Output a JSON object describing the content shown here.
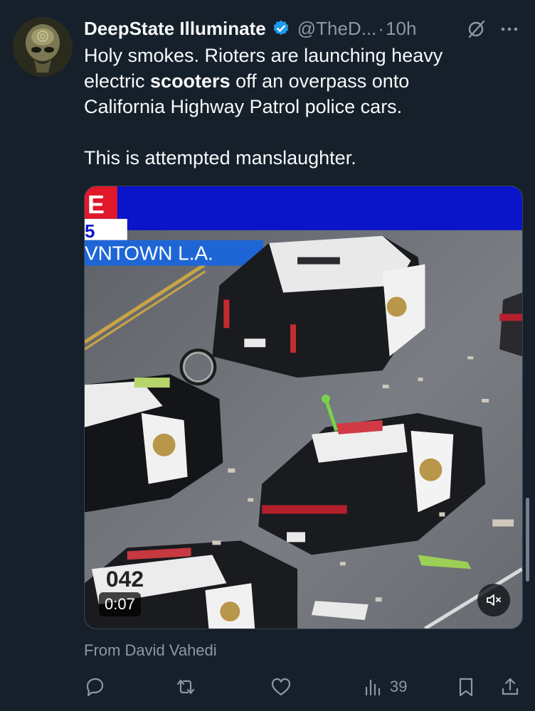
{
  "tweet": {
    "display_name": "DeepState Illuminate",
    "handle": "@TheD...",
    "separator": "·",
    "time": "10h",
    "body_lines": [
      "Holy smokes. Rioters are launching heavy",
      "electric ",
      "scooters",
      " off an overpass onto",
      "California Highway Patrol police cars.",
      "This is attempted manslaughter."
    ],
    "verified": true
  },
  "media": {
    "duration": "0:07",
    "broadcast_overlay": {
      "top_fragment": "E",
      "middle_fragment": "5",
      "location_fragment": "VNTOWN L.A."
    },
    "vehicle_number": "042",
    "muted": true
  },
  "source": "From David Vahedi",
  "actions": {
    "views": "39"
  },
  "colors": {
    "background": "#15202b",
    "text_primary": "#f7f9f9",
    "text_secondary": "#8b98a5",
    "verified_blue": "#1d9bf0",
    "broadcast_blue": "#0a14c8"
  },
  "icons": [
    "verified-badge-icon",
    "grok-icon",
    "more-icon",
    "reply-icon",
    "repost-icon",
    "like-icon",
    "views-icon",
    "bookmark-icon",
    "share-icon",
    "mute-icon"
  ]
}
